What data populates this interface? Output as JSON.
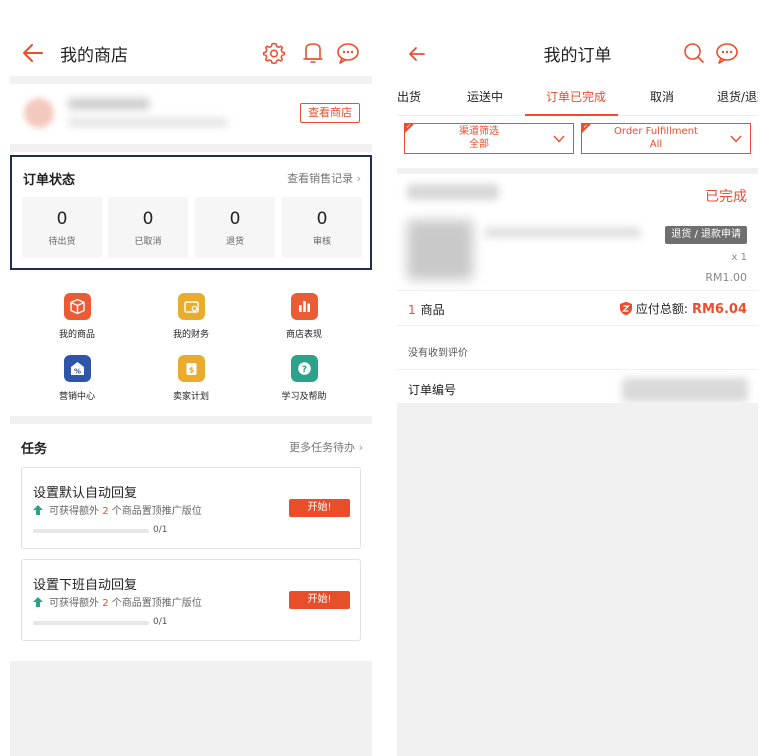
{
  "left": {
    "header": {
      "title": "我的商店"
    },
    "shop": {
      "view_shop_label": "查看商店"
    },
    "order_status": {
      "title": "订单状态",
      "link": "查看销售记录",
      "cards": [
        {
          "value": "0",
          "label": "待出货"
        },
        {
          "value": "0",
          "label": "已取消"
        },
        {
          "value": "0",
          "label": "退货"
        },
        {
          "value": "0",
          "label": "审核"
        }
      ]
    },
    "menu": [
      {
        "label": "我的商品",
        "icon": "box-icon",
        "color": "#e95c34"
      },
      {
        "label": "我的财务",
        "icon": "wallet-icon",
        "color": "#e9ac2f"
      },
      {
        "label": "商店表现",
        "icon": "bar-chart-icon",
        "color": "#e95c34"
      },
      {
        "label": "营销中心",
        "icon": "discount-tag-icon",
        "color": "#2d55a9"
      },
      {
        "label": "卖家计划",
        "icon": "dollar-bag-icon",
        "color": "#e9ac2f"
      },
      {
        "label": "学习及帮助",
        "icon": "question-icon",
        "color": "#2ba38b"
      }
    ],
    "tasks": {
      "title": "任务",
      "link": "更多任务待办",
      "items": [
        {
          "title": "设置默认自动回复",
          "sub_pre": "可获得额外",
          "sub_num": "2",
          "sub_post": "个商品置顶推广版位",
          "button": "开始!",
          "progress_text": "0/1",
          "progress": 0
        },
        {
          "title": "设置下班自动回复",
          "sub_pre": "可获得额外",
          "sub_num": "2",
          "sub_post": "个商品置顶推广版位",
          "button": "开始!",
          "progress_text": "0/1",
          "progress": 0
        }
      ]
    }
  },
  "right": {
    "header": {
      "title": "我的订单"
    },
    "tabs": [
      {
        "label": "待出货",
        "active": false
      },
      {
        "label": "运送中",
        "active": false
      },
      {
        "label": "订单已完成",
        "active": true
      },
      {
        "label": "取消",
        "active": false
      },
      {
        "label": "退货/退款",
        "active": false
      }
    ],
    "filters": [
      {
        "line1": "渠道筛选",
        "line2": "全部"
      },
      {
        "line1": "Order Fulfillment",
        "line2": "All"
      }
    ],
    "order": {
      "status": "已完成",
      "refund_button": "退货 / 退款申请",
      "quantity": "x 1",
      "unit_price": "RM1.00",
      "items_count": "1",
      "items_label": "商品",
      "total_label": "应付总额:",
      "total_amount": "RM6.04",
      "review_text": "没有收到评价",
      "order_no_label": "订单编号"
    }
  },
  "colors": {
    "accent": "#ee4d2d",
    "highlight_border": "#1f2d4f",
    "separator": "#f1f1f1"
  }
}
